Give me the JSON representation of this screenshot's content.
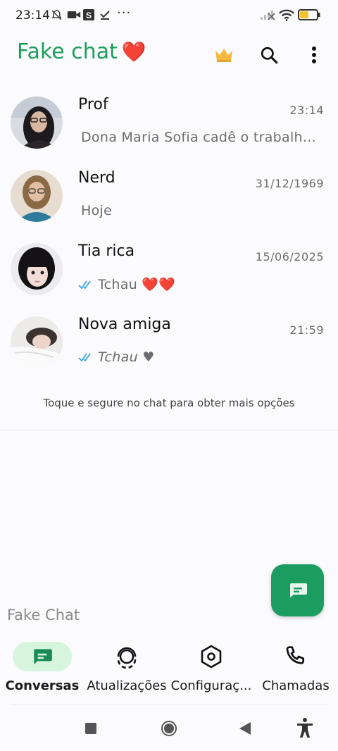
{
  "status_bar": {
    "time": "23:14",
    "dots": "···",
    "battery": "45"
  },
  "app_bar": {
    "title": "Fake chat",
    "title_emoji": "❤️"
  },
  "chats": [
    {
      "name": "Prof",
      "time": "23:14",
      "message": "Dona Maria Sofia cadê o trabalh...",
      "ticks": false
    },
    {
      "name": "Nerd",
      "time": "31/12/1969",
      "message": "Hoje",
      "ticks": false
    },
    {
      "name": "Tia rica",
      "time": "15/06/2025",
      "message": "Tchau ❤️❤️",
      "ticks": true
    },
    {
      "name": "Nova amiga",
      "time": "21:59",
      "message": "Tchau ♥",
      "ticks": true
    }
  ],
  "hint": "Toque e segure no chat para obter mais opções",
  "footer_label": "Fake Chat",
  "nav": [
    {
      "label": "Conversas",
      "active": true
    },
    {
      "label": "Atualizações",
      "active": false
    },
    {
      "label": "Configuraç...",
      "active": false
    },
    {
      "label": "Chamadas",
      "active": false
    }
  ],
  "colors": {
    "accent": "#1e9e5c",
    "fab": "#1b9d61",
    "nav_active_bg": "#d6f5dc",
    "tick_blue": "#3aa7e8"
  }
}
